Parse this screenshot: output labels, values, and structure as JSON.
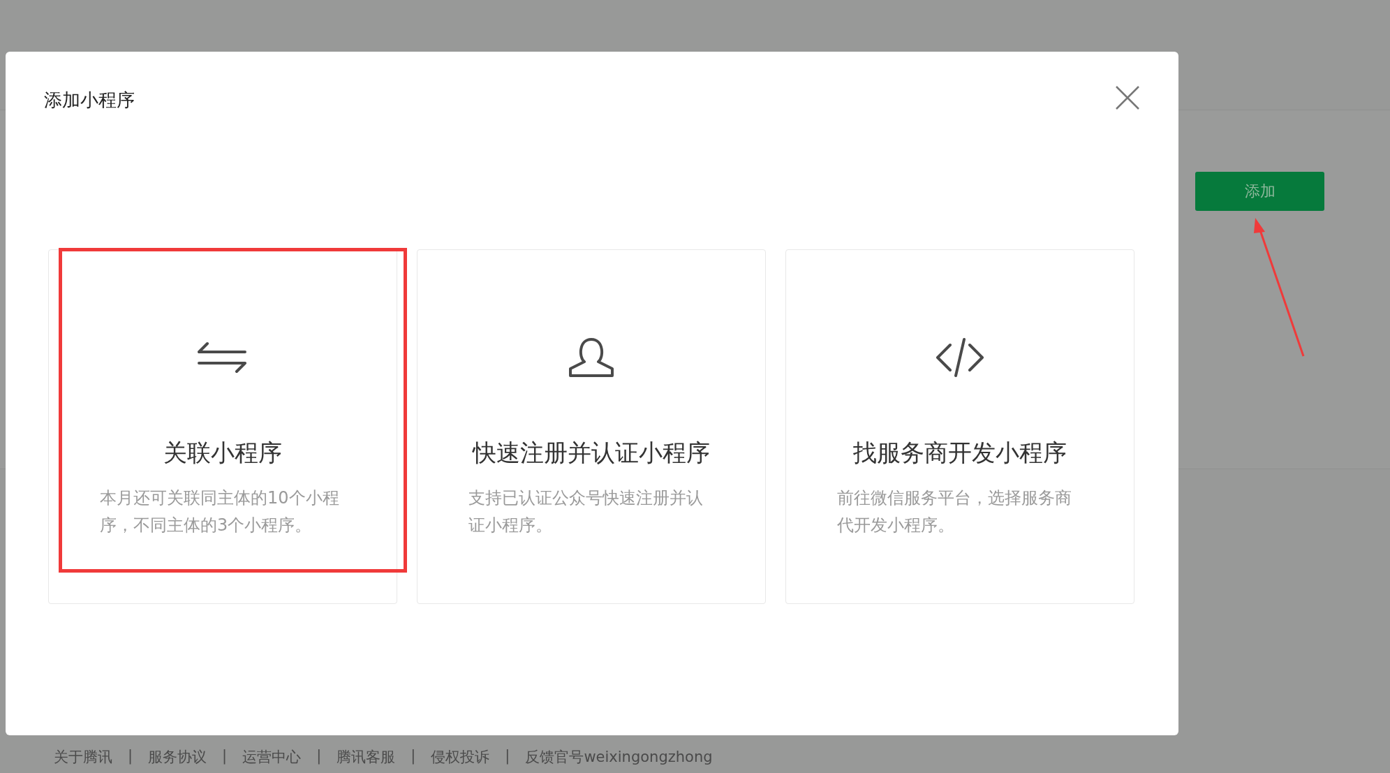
{
  "page": {
    "add_button": "添加"
  },
  "dialog": {
    "title": "添加小程序",
    "options": [
      {
        "kind": "link",
        "title": "关联小程序",
        "description": "本月还可关联同主体的10个小程序，不同主体的3个小程序。",
        "highlighted": true
      },
      {
        "kind": "register",
        "title": "快速注册并认证小程序",
        "description": "支持已认证公众号快速注册并认证小程序。",
        "highlighted": false
      },
      {
        "kind": "code",
        "title": "找服务商开发小程序",
        "description": "前往微信服务平台，选择服务商代开发小程序。",
        "highlighted": false
      }
    ]
  },
  "footer": {
    "separator": "|",
    "links": [
      "关于腾讯",
      "服务协议",
      "运营中心",
      "腾讯客服",
      "侵权投诉",
      "反馈官号weixingongzhong"
    ]
  }
}
